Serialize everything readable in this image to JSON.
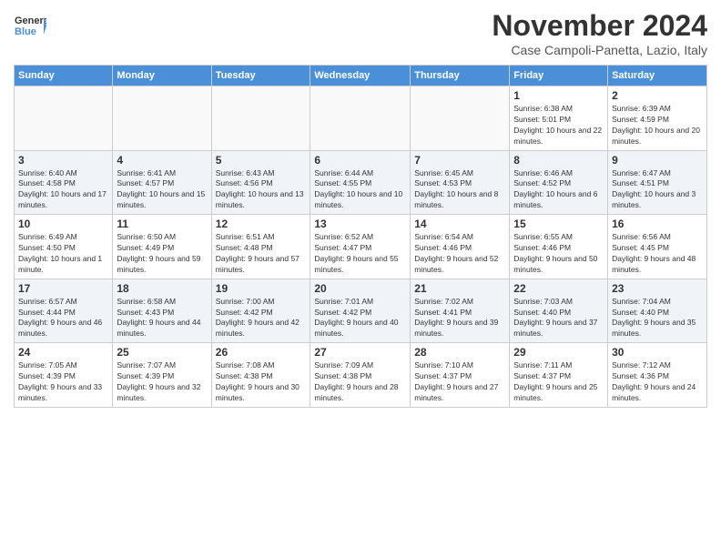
{
  "header": {
    "logo": "GeneralBlue",
    "month_title": "November 2024",
    "location": "Case Campoli-Panetta, Lazio, Italy"
  },
  "days_of_week": [
    "Sunday",
    "Monday",
    "Tuesday",
    "Wednesday",
    "Thursday",
    "Friday",
    "Saturday"
  ],
  "weeks": [
    [
      {
        "day": "",
        "empty": true
      },
      {
        "day": "",
        "empty": true
      },
      {
        "day": "",
        "empty": true
      },
      {
        "day": "",
        "empty": true
      },
      {
        "day": "",
        "empty": true
      },
      {
        "day": "1",
        "sunrise": "Sunrise: 6:38 AM",
        "sunset": "Sunset: 5:01 PM",
        "daylight": "Daylight: 10 hours and 22 minutes."
      },
      {
        "day": "2",
        "sunrise": "Sunrise: 6:39 AM",
        "sunset": "Sunset: 4:59 PM",
        "daylight": "Daylight: 10 hours and 20 minutes."
      }
    ],
    [
      {
        "day": "3",
        "sunrise": "Sunrise: 6:40 AM",
        "sunset": "Sunset: 4:58 PM",
        "daylight": "Daylight: 10 hours and 17 minutes."
      },
      {
        "day": "4",
        "sunrise": "Sunrise: 6:41 AM",
        "sunset": "Sunset: 4:57 PM",
        "daylight": "Daylight: 10 hours and 15 minutes."
      },
      {
        "day": "5",
        "sunrise": "Sunrise: 6:43 AM",
        "sunset": "Sunset: 4:56 PM",
        "daylight": "Daylight: 10 hours and 13 minutes."
      },
      {
        "day": "6",
        "sunrise": "Sunrise: 6:44 AM",
        "sunset": "Sunset: 4:55 PM",
        "daylight": "Daylight: 10 hours and 10 minutes."
      },
      {
        "day": "7",
        "sunrise": "Sunrise: 6:45 AM",
        "sunset": "Sunset: 4:53 PM",
        "daylight": "Daylight: 10 hours and 8 minutes."
      },
      {
        "day": "8",
        "sunrise": "Sunrise: 6:46 AM",
        "sunset": "Sunset: 4:52 PM",
        "daylight": "Daylight: 10 hours and 6 minutes."
      },
      {
        "day": "9",
        "sunrise": "Sunrise: 6:47 AM",
        "sunset": "Sunset: 4:51 PM",
        "daylight": "Daylight: 10 hours and 3 minutes."
      }
    ],
    [
      {
        "day": "10",
        "sunrise": "Sunrise: 6:49 AM",
        "sunset": "Sunset: 4:50 PM",
        "daylight": "Daylight: 10 hours and 1 minute."
      },
      {
        "day": "11",
        "sunrise": "Sunrise: 6:50 AM",
        "sunset": "Sunset: 4:49 PM",
        "daylight": "Daylight: 9 hours and 59 minutes."
      },
      {
        "day": "12",
        "sunrise": "Sunrise: 6:51 AM",
        "sunset": "Sunset: 4:48 PM",
        "daylight": "Daylight: 9 hours and 57 minutes."
      },
      {
        "day": "13",
        "sunrise": "Sunrise: 6:52 AM",
        "sunset": "Sunset: 4:47 PM",
        "daylight": "Daylight: 9 hours and 55 minutes."
      },
      {
        "day": "14",
        "sunrise": "Sunrise: 6:54 AM",
        "sunset": "Sunset: 4:46 PM",
        "daylight": "Daylight: 9 hours and 52 minutes."
      },
      {
        "day": "15",
        "sunrise": "Sunrise: 6:55 AM",
        "sunset": "Sunset: 4:46 PM",
        "daylight": "Daylight: 9 hours and 50 minutes."
      },
      {
        "day": "16",
        "sunrise": "Sunrise: 6:56 AM",
        "sunset": "Sunset: 4:45 PM",
        "daylight": "Daylight: 9 hours and 48 minutes."
      }
    ],
    [
      {
        "day": "17",
        "sunrise": "Sunrise: 6:57 AM",
        "sunset": "Sunset: 4:44 PM",
        "daylight": "Daylight: 9 hours and 46 minutes."
      },
      {
        "day": "18",
        "sunrise": "Sunrise: 6:58 AM",
        "sunset": "Sunset: 4:43 PM",
        "daylight": "Daylight: 9 hours and 44 minutes."
      },
      {
        "day": "19",
        "sunrise": "Sunrise: 7:00 AM",
        "sunset": "Sunset: 4:42 PM",
        "daylight": "Daylight: 9 hours and 42 minutes."
      },
      {
        "day": "20",
        "sunrise": "Sunrise: 7:01 AM",
        "sunset": "Sunset: 4:42 PM",
        "daylight": "Daylight: 9 hours and 40 minutes."
      },
      {
        "day": "21",
        "sunrise": "Sunrise: 7:02 AM",
        "sunset": "Sunset: 4:41 PM",
        "daylight": "Daylight: 9 hours and 39 minutes."
      },
      {
        "day": "22",
        "sunrise": "Sunrise: 7:03 AM",
        "sunset": "Sunset: 4:40 PM",
        "daylight": "Daylight: 9 hours and 37 minutes."
      },
      {
        "day": "23",
        "sunrise": "Sunrise: 7:04 AM",
        "sunset": "Sunset: 4:40 PM",
        "daylight": "Daylight: 9 hours and 35 minutes."
      }
    ],
    [
      {
        "day": "24",
        "sunrise": "Sunrise: 7:05 AM",
        "sunset": "Sunset: 4:39 PM",
        "daylight": "Daylight: 9 hours and 33 minutes."
      },
      {
        "day": "25",
        "sunrise": "Sunrise: 7:07 AM",
        "sunset": "Sunset: 4:39 PM",
        "daylight": "Daylight: 9 hours and 32 minutes."
      },
      {
        "day": "26",
        "sunrise": "Sunrise: 7:08 AM",
        "sunset": "Sunset: 4:38 PM",
        "daylight": "Daylight: 9 hours and 30 minutes."
      },
      {
        "day": "27",
        "sunrise": "Sunrise: 7:09 AM",
        "sunset": "Sunset: 4:38 PM",
        "daylight": "Daylight: 9 hours and 28 minutes."
      },
      {
        "day": "28",
        "sunrise": "Sunrise: 7:10 AM",
        "sunset": "Sunset: 4:37 PM",
        "daylight": "Daylight: 9 hours and 27 minutes."
      },
      {
        "day": "29",
        "sunrise": "Sunrise: 7:11 AM",
        "sunset": "Sunset: 4:37 PM",
        "daylight": "Daylight: 9 hours and 25 minutes."
      },
      {
        "day": "30",
        "sunrise": "Sunrise: 7:12 AM",
        "sunset": "Sunset: 4:36 PM",
        "daylight": "Daylight: 9 hours and 24 minutes."
      }
    ]
  ]
}
